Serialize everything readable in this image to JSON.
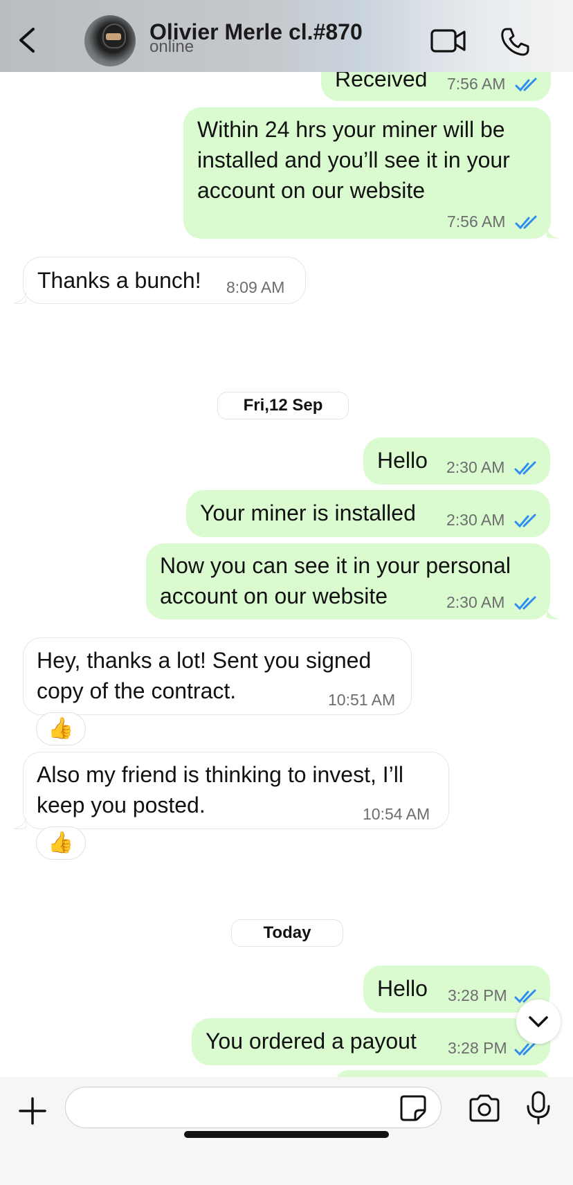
{
  "header": {
    "contact_name": "Olivier Merle cl.#870",
    "status": "online"
  },
  "messages": [
    {
      "dir": "out",
      "text": "Received",
      "time": "7:56 AM",
      "read": true
    },
    {
      "dir": "out",
      "text": "Within 24 hrs your miner will be installed and you’ll see it in your account on our website",
      "time": "7:56 AM",
      "read": true
    },
    {
      "dir": "in",
      "text": "Thanks a bunch!",
      "time": "8:09 AM"
    },
    {
      "dir": "out",
      "text": "Hello",
      "time": "2:30 AM",
      "read": true
    },
    {
      "dir": "out",
      "text": "Your miner is installed",
      "time": "2:30 AM",
      "read": true
    },
    {
      "dir": "out",
      "text": "Now you can see it in your personal account on our website",
      "time": "2:30 AM",
      "read": true
    },
    {
      "dir": "in",
      "text": "Hey, thanks a lot! Sent you signed copy of the contract.",
      "time": "10:51 AM",
      "reaction": "👍"
    },
    {
      "dir": "in",
      "text": "Also my friend is thinking to invest, I’ll keep you posted.",
      "time": "10:54 AM",
      "reaction": "👍"
    },
    {
      "dir": "out",
      "text": "Hello",
      "time": "3:28 PM",
      "read": true
    },
    {
      "dir": "out",
      "text": "You ordered a payout",
      "time": "3:28 PM",
      "read": true
    }
  ],
  "date_separators": [
    "Fri,12 Sep",
    "Today"
  ],
  "input": {
    "value": "",
    "placeholder": ""
  },
  "icons": {
    "back": "chevron-left-icon",
    "video": "video-camera-icon",
    "phone": "phone-icon",
    "attach": "plus-icon",
    "sticker": "sticker-icon",
    "camera": "camera-icon",
    "mic": "microphone-icon",
    "scroll": "chevron-down-icon"
  },
  "colors": {
    "outgoing_bubble": "#dafbd0",
    "incoming_bubble": "#ffffff",
    "read_ticks": "#2f8cf0"
  }
}
